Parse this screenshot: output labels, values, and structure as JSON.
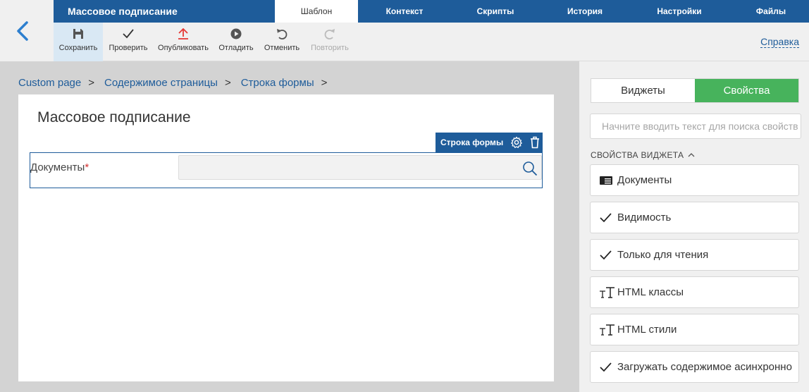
{
  "app": {
    "title": "Массовое подписание",
    "tabs": [
      "Шаблон",
      "Контекст",
      "Скрипты",
      "История",
      "Настройки",
      "Файлы"
    ],
    "active_tab": "Шаблон"
  },
  "toolbar": {
    "save": "Сохранить",
    "check": "Проверить",
    "publish": "Опубликовать",
    "debug": "Отладить",
    "undo": "Отменить",
    "redo": "Повторить",
    "help": "Справка"
  },
  "breadcrumb": [
    "Custom page",
    "Содержимое страницы",
    "Строка формы"
  ],
  "canvas": {
    "page_title": "Массовое подписание",
    "row_toolbar_label": "Строка формы",
    "field_label": "Документы",
    "field_required_mark": "*",
    "field_value": ""
  },
  "panel": {
    "tabs": [
      "Виджеты",
      "Свойства"
    ],
    "active_tab": "Свойства",
    "search_placeholder": "Начните вводить текст для поиска свойств",
    "section_title": "СВОЙСТВА ВИДЖЕТА",
    "properties": [
      {
        "label": "Документы",
        "icon": "widget-card-icon"
      },
      {
        "label": "Видимость",
        "icon": "check-icon"
      },
      {
        "label": "Только для чтения",
        "icon": "check-icon"
      },
      {
        "label": "HTML классы",
        "icon": "text-type-icon"
      },
      {
        "label": "HTML стили",
        "icon": "text-type-icon"
      },
      {
        "label": "Загружать содержимое асинхронно",
        "icon": "check-icon"
      }
    ]
  },
  "colors": {
    "primary": "#1e5c9a",
    "accent_green": "#47b35c",
    "required": "#d32f2f",
    "publish_icon": "#e53935"
  }
}
